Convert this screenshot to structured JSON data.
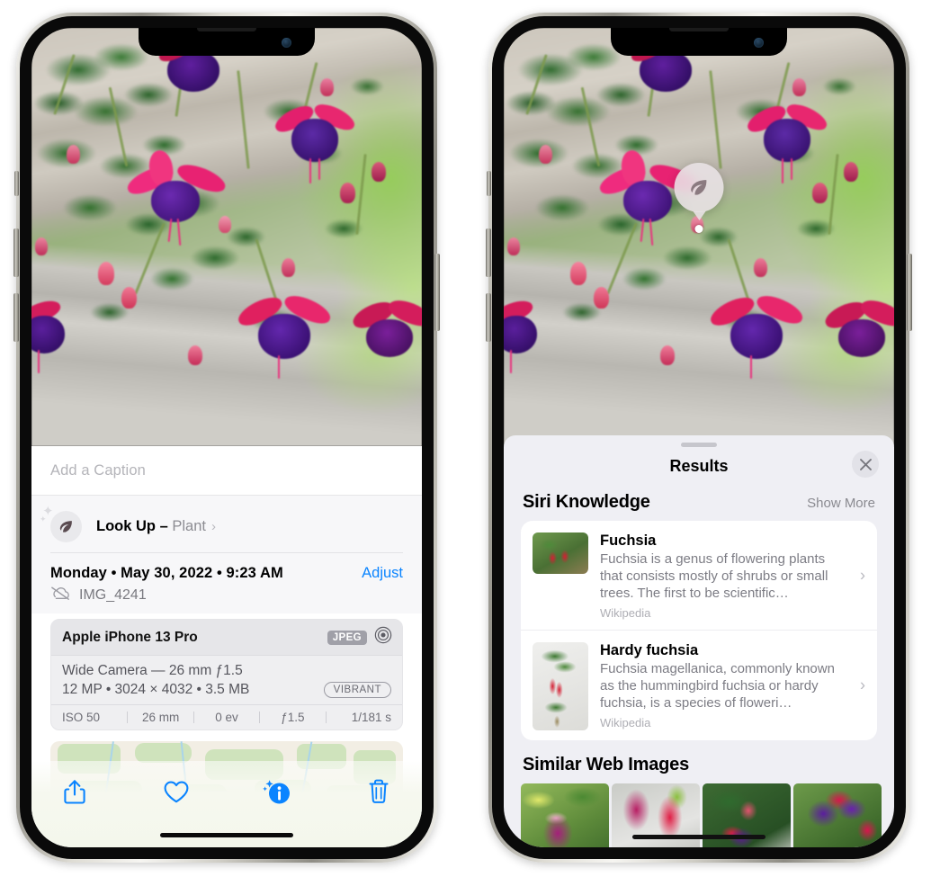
{
  "left_phone": {
    "caption_placeholder": "Add a Caption",
    "lookup": {
      "icon": "leaf-icon",
      "label": "Look Up – ",
      "subject": "Plant",
      "chevron": "›"
    },
    "metadata": {
      "date": "Monday • May 30, 2022 • 9:23 AM",
      "adjust_label": "Adjust",
      "cloud_icon": "cloud-slash-icon",
      "filename": "IMG_4241"
    },
    "camera_card": {
      "model": "Apple iPhone 13 Pro",
      "format_badge": "JPEG",
      "lens_icon": "raw-circle-icon",
      "lens_line": "Wide Camera — 26 mm ƒ1.5",
      "specs_line": "12 MP • 3024 × 4032 • 3.5 MB",
      "style_badge": "VIBRANT",
      "exif": [
        "ISO 50",
        "26 mm",
        "0 ev",
        "ƒ1.5",
        "1/181 s"
      ]
    },
    "toolbar": [
      {
        "name": "share-button",
        "icon": "share-icon"
      },
      {
        "name": "favorite-button",
        "icon": "heart-icon"
      },
      {
        "name": "info-button",
        "icon": "info-sparkle-icon"
      },
      {
        "name": "delete-button",
        "icon": "trash-icon"
      }
    ],
    "accent_color": "#0a84ff"
  },
  "right_phone": {
    "photo_badge": {
      "icon": "leaf-icon"
    },
    "sheet": {
      "title": "Results",
      "close_icon": "close-icon"
    },
    "siri_knowledge": {
      "heading": "Siri Knowledge",
      "show_more": "Show More",
      "results": [
        {
          "title": "Fuchsia",
          "description": "Fuchsia is a genus of flowering plants that consists mostly of shrubs or small trees. The first to be scientific…",
          "source": "Wikipedia",
          "thumb": "fuchsia-red-flowers-thumb"
        },
        {
          "title": "Hardy fuchsia",
          "description": "Fuchsia magellanica, commonly known as the hummingbird fuchsia or hardy fuchsia, is a species of floweri…",
          "source": "Wikipedia",
          "thumb": "hardy-fuchsia-branch-thumb"
        }
      ]
    },
    "similar_web_images": {
      "heading": "Similar Web Images",
      "thumbs": [
        "fuchsia-pink-white-thumb",
        "fuchsia-red-closeup-thumb",
        "fuchsia-bush-buds-thumb",
        "fuchsia-purple-red-thumb"
      ]
    }
  }
}
